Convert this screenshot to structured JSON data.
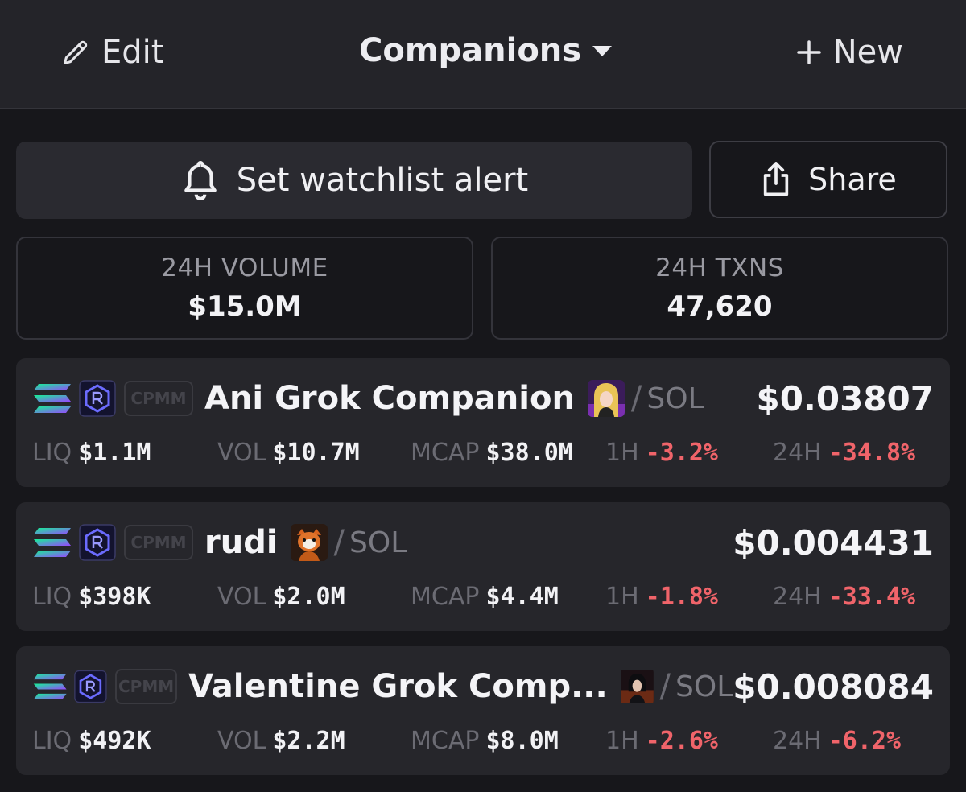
{
  "header": {
    "edit_label": "Edit",
    "title": "Companions",
    "new_label": "New"
  },
  "actions": {
    "alert_label": "Set watchlist alert",
    "share_label": "Share"
  },
  "stats": {
    "volume_label": "24H VOLUME",
    "volume_value": "$15.0M",
    "txns_label": "24H TXNS",
    "txns_value": "47,620"
  },
  "labels": {
    "pool_type": "CPMM",
    "liq": "LIQ",
    "vol": "VOL",
    "mcap": "MCAP",
    "h1": "1H",
    "h24": "24H",
    "slash": "/"
  },
  "pairs": [
    {
      "name": "Ani Grok Companion",
      "quote": "SOL",
      "price": "$0.03807",
      "liq": "$1.1M",
      "vol": "$10.7M",
      "mcap": "$38.0M",
      "change_1h": "-3.2%",
      "change_24h": "-34.8%",
      "avatar_icon": "anime-girl-avatar-icon"
    },
    {
      "name": "rudi",
      "quote": "SOL",
      "price": "$0.004431",
      "liq": "$398K",
      "vol": "$2.0M",
      "mcap": "$4.4M",
      "change_1h": "-1.8%",
      "change_24h": "-33.4%",
      "avatar_icon": "red-panda-avatar-icon"
    },
    {
      "name": "Valentine Grok Comp...",
      "quote": "SOL",
      "price": "$0.008084",
      "liq": "$492K",
      "vol": "$2.2M",
      "mcap": "$8.0M",
      "change_1h": "-2.6%",
      "change_24h": "-6.2%",
      "avatar_icon": "dark-hair-avatar-icon"
    }
  ],
  "colors": {
    "background": "#17171b",
    "card": "#26262b",
    "negative": "#f0646a",
    "solana_gradient": [
      "#9945ff",
      "#14f195"
    ],
    "raydium": "#6b6bff"
  }
}
